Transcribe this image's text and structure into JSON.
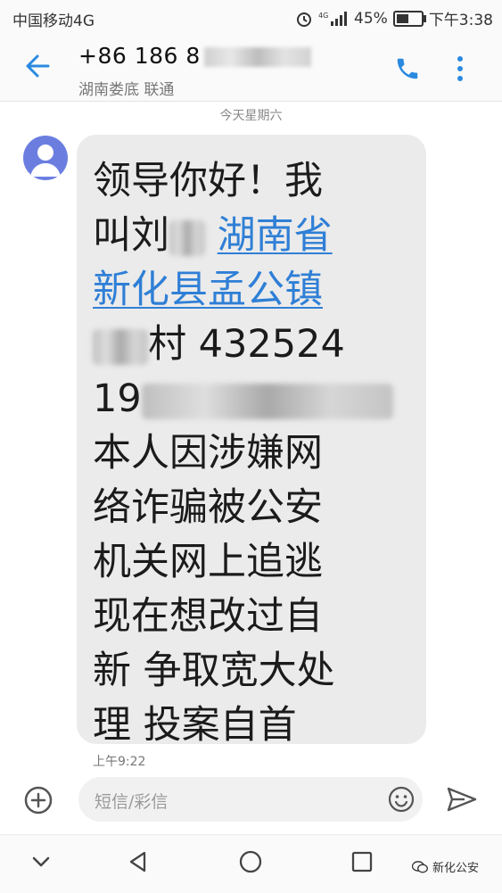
{
  "status_bar": {
    "carrier": "中国移动4G",
    "battery_percent": "45%",
    "time": "下午3:38",
    "icons": [
      "alarm-icon",
      "4g-signal-icon",
      "battery-icon"
    ]
  },
  "header": {
    "contact_number_visible": "+86 186 8",
    "contact_location": "湖南娄底 联通",
    "back_icon": "arrow-left-icon",
    "call_icon": "phone-icon",
    "more_icon": "more-vertical-icon"
  },
  "thread": {
    "date_label": "今天星期六",
    "message": {
      "line1": "领导你好！我",
      "line2_prefix": "叫刘",
      "line2_link": "湖南省",
      "line3_link": "新化县孟公镇",
      "line4_suffix": "村 432524",
      "line5_prefix": "19",
      "line6": "本人因涉嫌网",
      "line7": "络诈骗被公安",
      "line8": "机关网上追逃",
      "line9": "现在想改过自",
      "line10": "新 争取宽大处",
      "line11": "理 投案自首"
    },
    "time": "上午9:22"
  },
  "compose": {
    "placeholder": "短信/彩信",
    "attach_icon": "plus-circle-icon",
    "emoji_icon": "smiley-icon",
    "send_icon": "send-icon"
  },
  "nav": {
    "watermark": "新化公安"
  },
  "colors": {
    "accent": "#2a8ae0",
    "link": "#2f7fd6",
    "bubble": "#ebebeb",
    "avatar": "#6b7ee0"
  }
}
